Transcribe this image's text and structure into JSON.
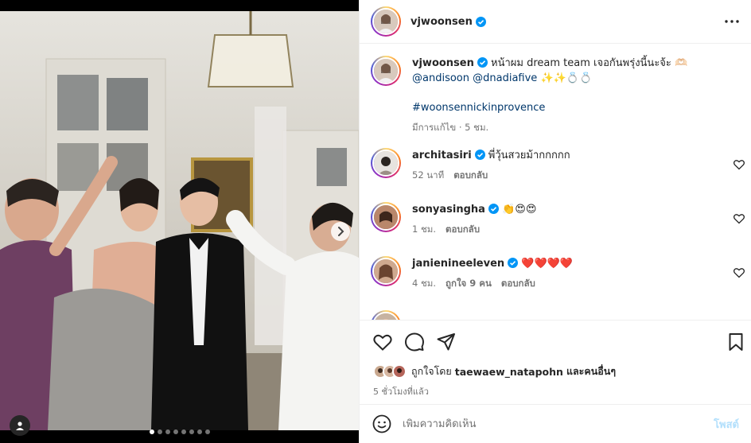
{
  "post": {
    "carousel": {
      "dot_count": 8,
      "active_index": 0
    },
    "header": {
      "username": "vjwoonsen"
    },
    "caption": {
      "username": "vjwoonsen",
      "text": "หน้าผม dream team เจอกันพรุ่งนี้นะจ้ะ 🫶🏻",
      "mention_1": "@andisoon",
      "mention_2": "@dnadiafive",
      "emojis": "✨✨💍💍",
      "hashtag": "#woonsennickinprovence",
      "edited": "มีการแก้ไข · 5 ชม."
    },
    "comments": [
      {
        "username": "architasiri",
        "verified": true,
        "text": "พี่วุ้นสวยม้ากกกกก",
        "time": "52 นาที",
        "likes": "",
        "reply": "ตอบกลับ"
      },
      {
        "username": "sonyasingha",
        "verified": true,
        "text": "👏😍😍",
        "time": "1 ชม.",
        "likes": "",
        "reply": "ตอบกลับ"
      },
      {
        "username": "janienineeleven",
        "verified": true,
        "text": "❤️❤️❤️❤️",
        "time": "4 ชม.",
        "likes": "ถูกใจ 9 คน",
        "reply": "ตอบกลับ"
      },
      {
        "username": "",
        "verified": true,
        "text": "",
        "time": "",
        "likes": "",
        "reply": ""
      }
    ],
    "likes_text_prefix": "ถูกใจโดย",
    "likes_user": "taewaew_natapohn",
    "likes_suffix": "และคนอื่นๆ",
    "posted_time": "5 ชั่วโมงที่แล้ว",
    "composer": {
      "placeholder": "เพิ่มความคิดเห็น",
      "post_label": "โพสต์"
    }
  },
  "colors": {
    "link": "#00376b",
    "verified": "#0095f6",
    "muted": "#737373",
    "heart": "#ed4956",
    "post_disabled": "#b2dffc"
  },
  "icons": [
    "more-options-icon",
    "verified-icon",
    "heart-icon",
    "comment-icon",
    "share-icon",
    "bookmark-icon",
    "emoji-icon",
    "chevron-right-icon",
    "user-tag-icon"
  ]
}
